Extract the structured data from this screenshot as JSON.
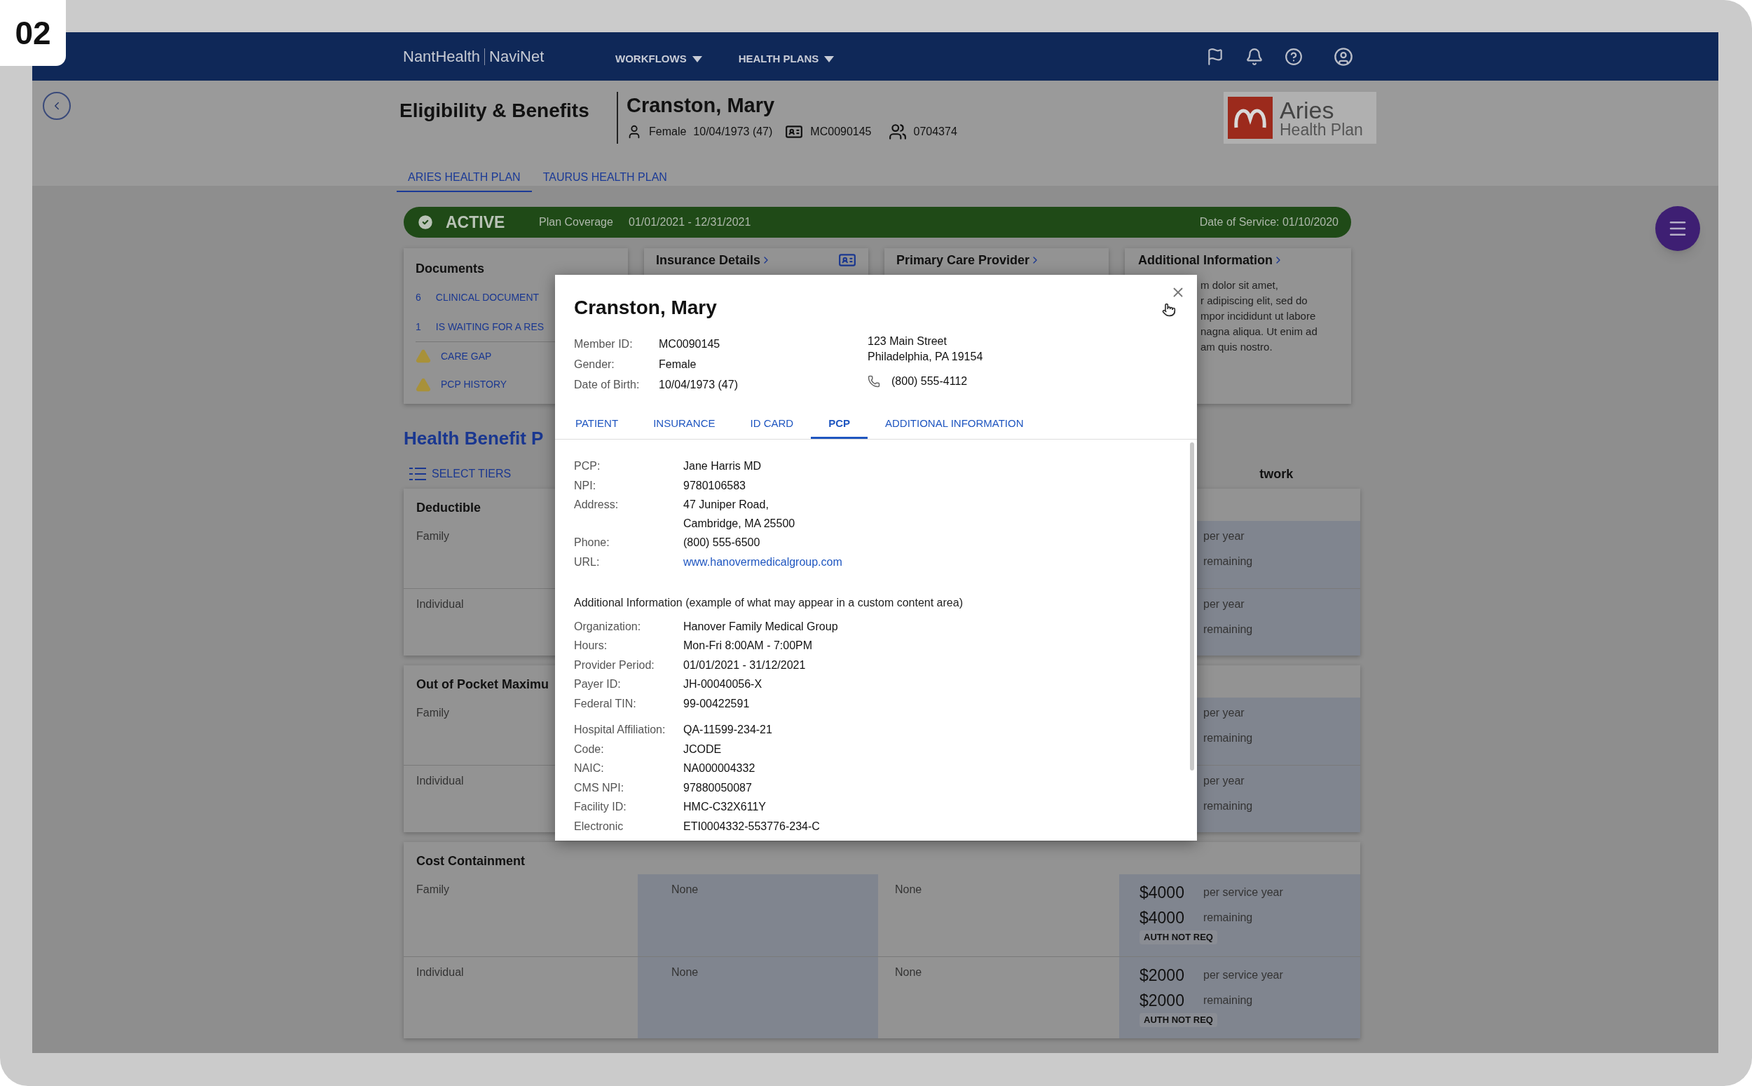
{
  "badge": "02",
  "nav": {
    "brand": "NantHealth",
    "product": "NaviNet",
    "menus": [
      {
        "label": "WORKFLOWS"
      },
      {
        "label": "HEALTH PLANS"
      }
    ]
  },
  "page_title": "Eligibility & Benefits",
  "patient": {
    "name": "Cranston, Mary",
    "gender": "Female",
    "dob": "10/04/1973 (47)",
    "member_id": "MC0090145",
    "group_id": "0704374"
  },
  "plan_logo": {
    "name": "Aries",
    "subtitle": "Health Plan"
  },
  "plan_tabs": [
    {
      "label": "ARIES HEALTH PLAN",
      "selected": true
    },
    {
      "label": "TAURUS HEALTH PLAN",
      "selected": false
    }
  ],
  "status": {
    "state": "ACTIVE",
    "active": true,
    "coverage_label": "Plan Coverage",
    "coverage": "01/01/2021 - 12/31/2021",
    "service_date": "Date of Service: 01/10/2020"
  },
  "documents": {
    "title": "Documents",
    "items": [
      {
        "kind": "count",
        "count": "6",
        "label": "CLINICAL DOCUMENT"
      },
      {
        "kind": "count",
        "count": "1",
        "label": "IS WAITING FOR A RES"
      },
      {
        "kind": "warning",
        "label": "CARE GAP"
      },
      {
        "kind": "warning",
        "label": "PCP HISTORY"
      }
    ]
  },
  "cards": [
    {
      "kind": "insurance",
      "title": "Insurance Details"
    },
    {
      "kind": "provider",
      "title": "Primary Care Provider"
    }
  ],
  "additional_card": {
    "title": "Additional Information",
    "lines": [
      "m dolor sit amet,",
      "r adipiscing elit, sed do",
      "mpor incididunt ut labore",
      "nagna aliqua. Ut enim ad",
      "am quis nostro."
    ]
  },
  "benefits": {
    "title": "Health Benefit P",
    "select_tiers": "SELECT TIERS",
    "column_4_heading": "twork",
    "sections": [
      {
        "title": "Deductible",
        "rows": [
          {
            "label": "Family",
            "column_4": {
              "unit": "per year",
              "remaining": "remaining"
            }
          },
          {
            "label": "Individual",
            "column_4": {
              "unit": "per year",
              "remaining": "remaining"
            }
          }
        ]
      },
      {
        "title": "Out of Pocket Maximu",
        "rows": [
          {
            "label": "Family",
            "column_4": {
              "unit": "per year",
              "remaining": "remaining"
            }
          },
          {
            "label": "Individual",
            "column_4": {
              "unit": "per year",
              "remaining": "remaining"
            }
          }
        ]
      },
      {
        "title": "Cost Containment",
        "rows": [
          {
            "label": "Family",
            "column_2": "None",
            "column_3": "None",
            "column_4": {
              "amount": "$4000",
              "unit": "per service year",
              "remaining_amount": "$4000",
              "remaining": "remaining",
              "tag": "AUTH NOT REQ"
            }
          },
          {
            "label": "Individual",
            "column_2": "None",
            "column_3": "None",
            "column_4": {
              "amount": "$2000",
              "unit": "per service year",
              "remaining_amount": "$2000",
              "remaining": "remaining",
              "tag": "AUTH NOT REQ"
            }
          }
        ]
      }
    ]
  },
  "modal": {
    "title": "Cranston, Mary",
    "fields": [
      {
        "label": "Member ID:",
        "value": "MC0090145"
      },
      {
        "label": "Gender:",
        "value": "Female"
      },
      {
        "label": "Date of Birth:",
        "value": "10/04/1973 (47)"
      }
    ],
    "address": [
      "123 Main Street",
      "Philadelphia, PA 19154"
    ],
    "phone": "(800) 555-4112",
    "tabs": [
      {
        "label": "PATIENT",
        "selected": false
      },
      {
        "label": "INSURANCE",
        "selected": false
      },
      {
        "label": "ID CARD",
        "selected": false
      },
      {
        "label": "PCP",
        "selected": true
      },
      {
        "label": "ADDITIONAL INFORMATION",
        "selected": false
      }
    ],
    "pcp_fields": [
      {
        "label": "PCP:",
        "lines": [
          "Jane Harris MD"
        ]
      },
      {
        "label": "NPI:",
        "lines": [
          "9780106583"
        ]
      },
      {
        "label": "Address:",
        "lines": [
          "47 Juniper Road,",
          "Cambridge, MA 25500"
        ]
      },
      {
        "label": "Phone:",
        "lines": [
          "(800) 555-6500"
        ]
      },
      {
        "label": "URL:",
        "kind": "link",
        "lines": [
          "www.hanovermedicalgroup.com"
        ]
      }
    ],
    "note": "Additional Information (example of what may appear in a custom content area)",
    "groups": [
      [
        {
          "label": "Organization:",
          "value": "Hanover Family Medical Group"
        },
        {
          "label": "Hours:",
          "value": "Mon-Fri  8:00AM - 7:00PM"
        },
        {
          "label": "Provider Period:",
          "value": "01/01/2021 - 31/12/2021"
        },
        {
          "label": "Payer ID:",
          "value": "JH-00040056-X"
        },
        {
          "label": "Federal TIN:",
          "value": "99-00422591"
        }
      ],
      [
        {
          "label": "Hospital Affiliation:",
          "value": "QA-11599-234-21"
        },
        {
          "label": "Code:",
          "value": "JCODE"
        },
        {
          "label": "NAIC:",
          "value": "NA000004332"
        },
        {
          "label": "CMS NPI:",
          "value": "97880050087"
        },
        {
          "label": "Facility ID:",
          "value": "HMC-C32X611Y"
        },
        {
          "label": "Electronic",
          "value": "ETI0004332-553776-234-C"
        }
      ]
    ]
  }
}
